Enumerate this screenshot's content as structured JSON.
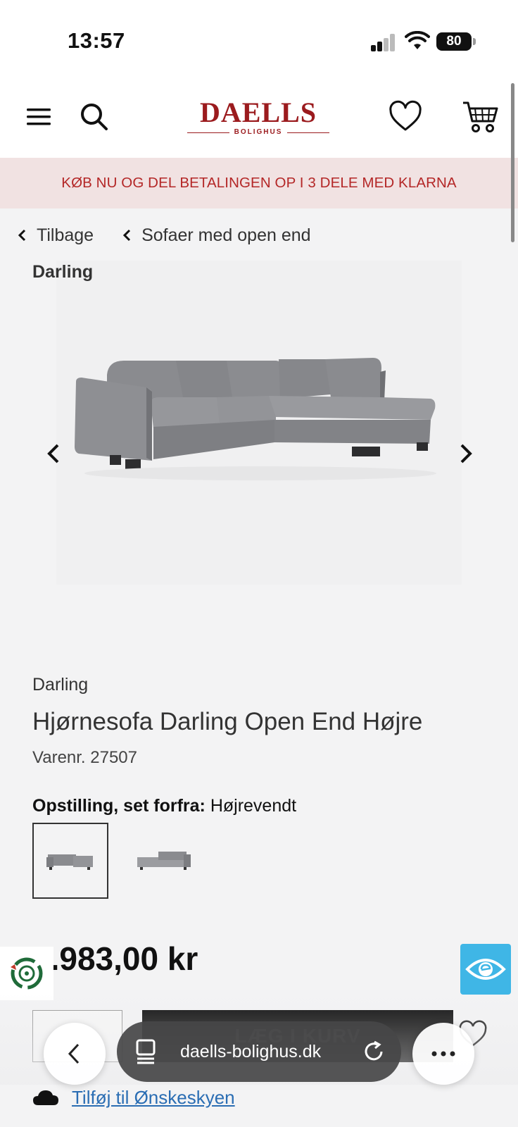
{
  "status_bar": {
    "time": "13:57",
    "battery": "80"
  },
  "header": {
    "menu_icon": "hamburger-menu-icon",
    "search_icon": "search-icon",
    "logo_main": "DAELLS",
    "logo_sub": "BOLIGHUS",
    "wishlist_icon": "heart-icon",
    "cart_icon": "cart-icon"
  },
  "promo": {
    "text": "KØB NU OG DEL BETALINGEN OP I 3 DELE MED KLARNA"
  },
  "breadcrumbs": [
    {
      "label": "Tilbage"
    },
    {
      "label": "Sofaer med open end"
    }
  ],
  "product": {
    "tag": "Darling",
    "brand": "Darling",
    "title": "Hjørnesofa Darling Open End Højre",
    "sku": "Varenr. 27507",
    "option_label": "Opstilling, set forfra:",
    "option_value": "Højrevendt",
    "price": "1.983,00 kr",
    "add_to_cart": "LÆG I KURV",
    "wishlist_link": "Tilføj til Ønskeskyen"
  },
  "browser": {
    "url": "daells-bolighus.dk"
  },
  "colors": {
    "brand_red": "#9b1b1e",
    "promo_bg": "#f1e2e2",
    "promo_text": "#b42727",
    "link_blue": "#2a6db3",
    "eye_badge": "#3fb6e6"
  }
}
